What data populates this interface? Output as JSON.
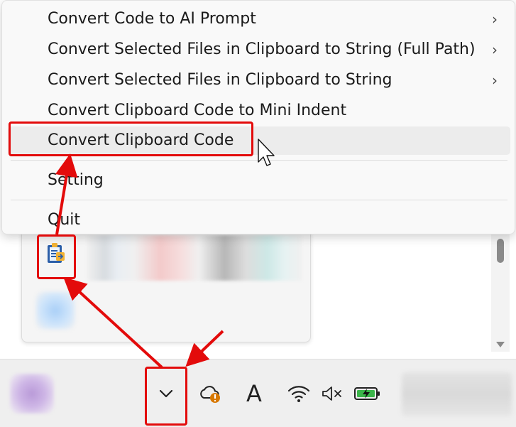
{
  "menu": {
    "items": [
      {
        "label": "Convert Code to AI Prompt",
        "has_submenu": true
      },
      {
        "label": "Convert Selected Files in Clipboard to String (Full Path)",
        "has_submenu": true
      },
      {
        "label": "Convert Selected Files in Clipboard to String",
        "has_submenu": true
      },
      {
        "label": "Convert Clipboard Code to Mini Indent",
        "has_submenu": false
      },
      {
        "label": "Convert Clipboard Code",
        "has_submenu": false,
        "hovered": true
      },
      {
        "label": "Setting",
        "has_submenu": false
      },
      {
        "label": "Quit",
        "has_submenu": false
      }
    ],
    "submenu_glyph": "›"
  },
  "tray": {
    "overflow_chevron": "⌄",
    "font_icon_glyph": "A",
    "icons": [
      "clipboard-converter-icon",
      "onedrive-warning-icon",
      "font-icon",
      "wifi-icon",
      "volume-muted-icon",
      "battery-charging-icon"
    ]
  },
  "colors": {
    "annotation_red": "#e30b0b",
    "battery_green": "#3bb54a",
    "warning_orange": "#d77800",
    "hover_bg": "#ececec"
  }
}
